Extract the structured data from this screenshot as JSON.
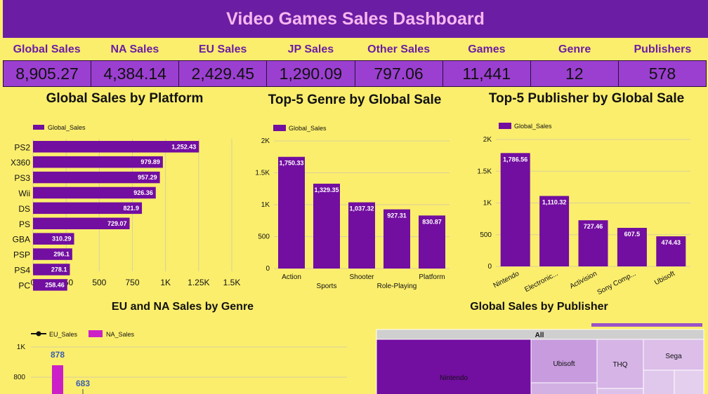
{
  "dashboard": {
    "title": "Video Games Sales Dashboard"
  },
  "kpis": [
    {
      "label": "Global Sales",
      "value": "8,905.27"
    },
    {
      "label": "NA Sales",
      "value": "4,384.14"
    },
    {
      "label": "EU Sales",
      "value": "2,429.45"
    },
    {
      "label": "JP Sales",
      "value": "1,290.09"
    },
    {
      "label": "Other Sales",
      "value": "797.06"
    },
    {
      "label": "Games",
      "value": "11,441"
    },
    {
      "label": "Genre",
      "value": "12"
    },
    {
      "label": "Publishers",
      "value": "578"
    }
  ],
  "colors": {
    "purple": "#6b1ea3",
    "bar": "#720ea0",
    "pink": "#cc1fc8",
    "background": "#fbee6d"
  },
  "chart_data": [
    {
      "type": "bar",
      "orientation": "horizontal",
      "title": "Global Sales by Platform",
      "legend": "Global_Sales",
      "categories": [
        "PS2",
        "X360",
        "PS3",
        "Wii",
        "DS",
        "PS",
        "GBA",
        "PSP",
        "PS4",
        "PC"
      ],
      "values": [
        1252.43,
        979.89,
        957.29,
        926.36,
        821.9,
        729.07,
        310.29,
        296.1,
        278.1,
        258.46
      ],
      "value_labels": [
        "1,252.43",
        "979.89",
        "957.29",
        "926.36",
        "821.9",
        "729.07",
        "310.29",
        "296.1",
        "278.1",
        "258.46"
      ],
      "xticks": [
        "0",
        "250",
        "500",
        "750",
        "1K",
        "1.25K",
        "1.5K"
      ],
      "xlim": [
        0,
        1500
      ]
    },
    {
      "type": "bar",
      "title": "Top-5 Genre by Global Sale",
      "legend": "Global_Sales",
      "categories": [
        "Action",
        "Sports",
        "Shooter",
        "Role-Playing",
        "Platform"
      ],
      "values": [
        1750.33,
        1329.35,
        1037.32,
        927.31,
        830.87
      ],
      "value_labels": [
        "1,750.33",
        "1,329.35",
        "1,037.32",
        "927.31",
        "830.87"
      ],
      "yticks": [
        "0",
        "500",
        "1K",
        "1.5K",
        "2K"
      ],
      "ylim": [
        0,
        2000
      ]
    },
    {
      "type": "bar",
      "title": "Top-5 Publisher by Global Sale",
      "legend": "Global_Sales",
      "categories": [
        "Nintendo",
        "Electronic...",
        "Activision",
        "Sony Comp...",
        "Ubisoft"
      ],
      "values": [
        1786.56,
        1110.32,
        727.46,
        607.5,
        474.43
      ],
      "value_labels": [
        "1,786.56",
        "1,110.32",
        "727.46",
        "607.5",
        "474.43"
      ],
      "yticks": [
        "0",
        "500",
        "1K",
        "1.5K",
        "2K"
      ],
      "ylim": [
        0,
        2000
      ]
    },
    {
      "type": "bar",
      "title": "EU and NA Sales by Genre",
      "series": [
        {
          "name": "EU_Sales",
          "style": "line"
        },
        {
          "name": "NA_Sales",
          "style": "bar"
        }
      ],
      "visible_values": [
        "878",
        "683"
      ],
      "yticks": [
        "800",
        "1K"
      ]
    },
    {
      "type": "treemap",
      "title": "Global Sales by Publisher",
      "root": "All",
      "items": [
        "Nintendo",
        "Ubisoft",
        "THQ",
        "Sega"
      ]
    }
  ]
}
